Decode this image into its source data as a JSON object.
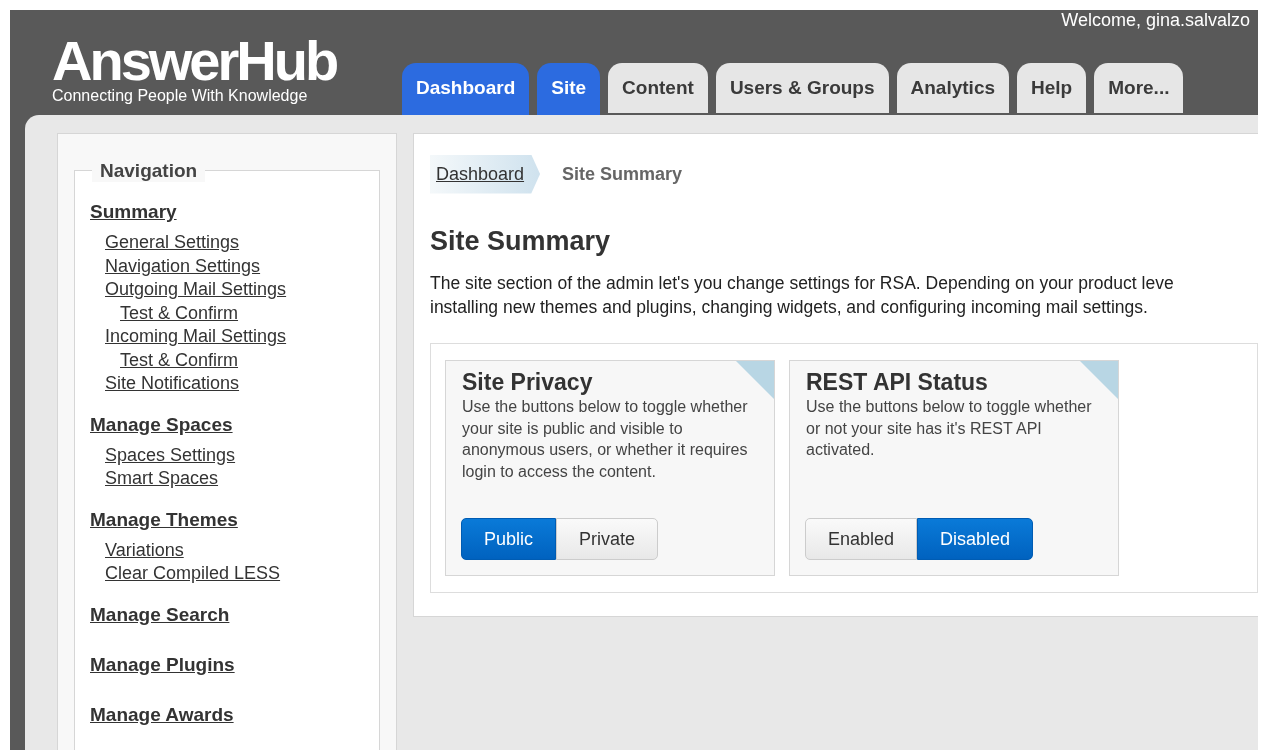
{
  "header": {
    "logo": "AnswerHub",
    "tagline": "Connecting People With Knowledge",
    "welcome": "Welcome, gina.salvalzo"
  },
  "tabs": [
    {
      "label": "Dashboard",
      "selected": true
    },
    {
      "label": "Site",
      "selected": true
    },
    {
      "label": "Content",
      "selected": false
    },
    {
      "label": "Users & Groups",
      "selected": false
    },
    {
      "label": "Analytics",
      "selected": false
    },
    {
      "label": "Help",
      "selected": false
    },
    {
      "label": "More...",
      "selected": false
    }
  ],
  "sidebar": {
    "title": "Navigation",
    "sections": [
      {
        "label": "Summary",
        "children": [
          {
            "label": "General Settings"
          },
          {
            "label": "Navigation Settings"
          },
          {
            "label": "Outgoing Mail Settings",
            "children": [
              {
                "label": "Test & Confirm"
              }
            ]
          },
          {
            "label": "Incoming Mail Settings",
            "children": [
              {
                "label": "Test & Confirm"
              }
            ]
          },
          {
            "label": "Site Notifications"
          }
        ]
      },
      {
        "label": "Manage Spaces",
        "children": [
          {
            "label": "Spaces Settings"
          },
          {
            "label": "Smart Spaces"
          }
        ]
      },
      {
        "label": "Manage Themes",
        "children": [
          {
            "label": "Variations"
          },
          {
            "label": "Clear Compiled LESS"
          }
        ]
      },
      {
        "label": "Manage Search"
      },
      {
        "label": "Manage Plugins"
      },
      {
        "label": "Manage Awards"
      }
    ]
  },
  "breadcrumb": [
    {
      "label": "Dashboard",
      "kind": "link"
    },
    {
      "label": "Site Summary",
      "kind": "current"
    }
  ],
  "page": {
    "title": "Site Summary",
    "intro": [
      "The site section of the admin let's you change settings for RSA. Depending on your product leve",
      "installing new themes and plugins, changing widgets, and configuring incoming mail settings."
    ]
  },
  "cards": [
    {
      "title": "Site Privacy",
      "description": "Use the buttons below to toggle whether your site is public and visible to anonymous users, or whether it requires login to access the content.",
      "options": [
        {
          "label": "Public",
          "selected": true
        },
        {
          "label": "Private",
          "selected": false
        }
      ]
    },
    {
      "title": "REST API Status",
      "description": "Use the buttons below to toggle whether or not your site has it's REST API activated.",
      "options": [
        {
          "label": "Enabled",
          "selected": false
        },
        {
          "label": "Disabled",
          "selected": true
        }
      ]
    }
  ]
}
